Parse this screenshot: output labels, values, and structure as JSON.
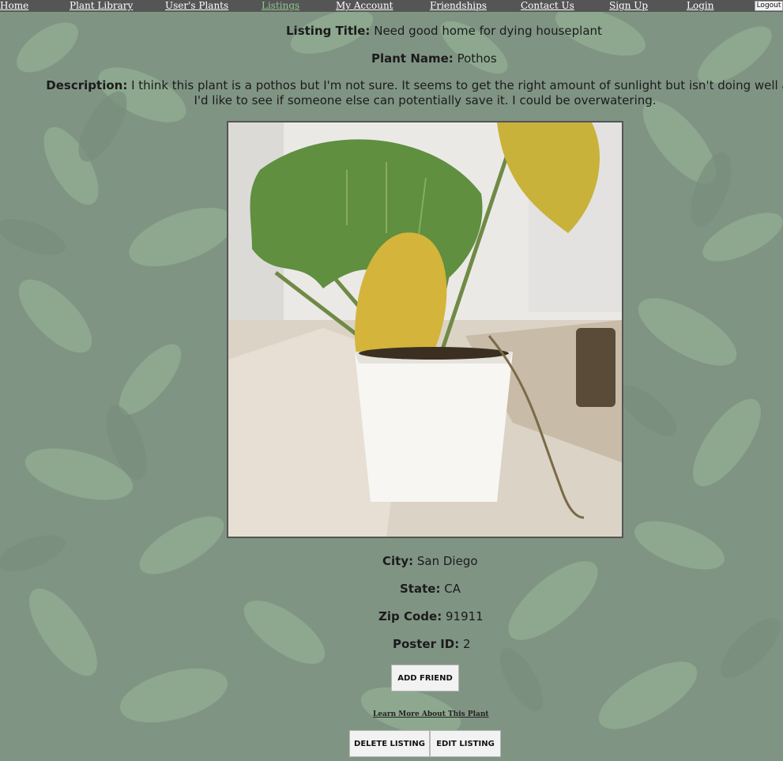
{
  "nav": {
    "items": [
      {
        "label": "Home"
      },
      {
        "label": "Plant Library"
      },
      {
        "label": "User's Plants"
      },
      {
        "label": "Listings",
        "active": true
      },
      {
        "label": "My Account"
      },
      {
        "label": "Friendships"
      },
      {
        "label": "Contact Us"
      },
      {
        "label": "Sign Up"
      },
      {
        "label": "Login"
      }
    ],
    "logout_label": "Logout"
  },
  "listing": {
    "title_label": "Listing Title:",
    "title_value": "Need good home for dying houseplant",
    "plant_name_label": "Plant Name:",
    "plant_name_value": "Pothos",
    "description_label": "Description:",
    "description_value": "I think this plant is a pothos but I'm not sure. It seems to get the right amount of sunlight but isn't doing well and I'd like to see if someone else can potentially save it. I could be overwatering.",
    "city_label": "City:",
    "city_value": "San Diego",
    "state_label": "State:",
    "state_value": "CA",
    "zip_label": "Zip Code:",
    "zip_value": "91911",
    "poster_label": "Poster ID:",
    "poster_value": "2"
  },
  "actions": {
    "add_friend": "ADD FRIEND",
    "learn_more": "Learn More About This Plant",
    "delete_listing": "DELETE LISTING",
    "edit_listing": "EDIT LISTING"
  },
  "colors": {
    "nav_bg": "#555555",
    "nav_active": "#90c890",
    "leaf_green": "#5e9a63"
  }
}
